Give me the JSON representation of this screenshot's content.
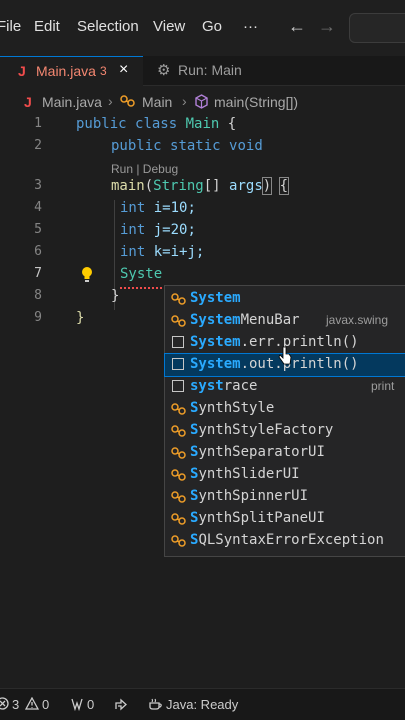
{
  "menubar": {
    "items": [
      "File",
      "Edit",
      "Selection",
      "View",
      "Go",
      "···"
    ],
    "back_icon": "arrow-left-icon",
    "forward_icon": "arrow-right-icon"
  },
  "tabs": [
    {
      "label": "Main.java",
      "icon": "J",
      "problems": "3",
      "close": "×"
    },
    {
      "label": "Run: Main",
      "icon": "run-icon"
    }
  ],
  "breadcrumb": [
    "Main.java",
    "Main",
    "main(String[])"
  ],
  "editor": {
    "line_numbers": [
      "1",
      "2",
      "3",
      "4",
      "5",
      "6",
      "7",
      "8",
      "9"
    ],
    "codelens": "Run | Debug",
    "lines": {
      "l1": {
        "kw1": "public",
        "kw2": "class",
        "cls": "Main",
        "brace": "{"
      },
      "l2": {
        "kw1": "public",
        "kw2": "static",
        "kw3": "void"
      },
      "l3": {
        "fn": "main",
        "open": "(",
        "type": "String",
        "arr": "[] ",
        "param": "args",
        "close": ")",
        "brace": "{"
      },
      "l4": {
        "kw": "int",
        "code": "i=10;"
      },
      "l5": {
        "kw": "int",
        "code": "j=20;"
      },
      "l6": {
        "kw": "int",
        "code": "k=i+j;"
      },
      "l7": {
        "typed": "Syste"
      },
      "l8": {
        "brace": "}"
      },
      "l9": {
        "brace": "}"
      }
    }
  },
  "suggest": {
    "items": [
      {
        "match": "System",
        "rest": "",
        "detail": "",
        "kind": "class-icon"
      },
      {
        "match": "System",
        "rest": "MenuBar",
        "detail": "javax.swing",
        "kind": "class-icon"
      },
      {
        "match": "System",
        "rest": ".err.println()",
        "detail": "",
        "kind": "snippet-icon"
      },
      {
        "match": "System",
        "rest": ".out.println()",
        "detail": "",
        "kind": "snippet-icon"
      },
      {
        "match": "syst",
        "rest": "race",
        "detail": "print",
        "kind": "snippet-icon"
      },
      {
        "match": "S",
        "rest": "ynthStyle",
        "detail": "",
        "kind": "class-icon"
      },
      {
        "match": "S",
        "rest": "ynthStyleFactory",
        "detail": "",
        "kind": "class-icon"
      },
      {
        "match": "S",
        "rest": "ynthSeparatorUI",
        "detail": "",
        "kind": "class-icon"
      },
      {
        "match": "S",
        "rest": "ynthSliderUI",
        "detail": "",
        "kind": "class-icon"
      },
      {
        "match": "S",
        "rest": "ynthSpinnerUI",
        "detail": "",
        "kind": "class-icon"
      },
      {
        "match": "S",
        "rest": "ynthSplitPaneUI",
        "detail": "",
        "kind": "class-icon"
      },
      {
        "match": "S",
        "rest": "QLSyntaxErrorException",
        "detail": "",
        "kind": "class-icon"
      }
    ],
    "selected_index": 3
  },
  "statusbar": {
    "errors": "3",
    "warnings": "0",
    "ports": "0",
    "java_status": "Java: Ready"
  },
  "colors": {
    "keyword": "#569cd6",
    "type": "#4ec9b0",
    "function": "#dcdcaa",
    "variable": "#9cdcfe",
    "match_highlight": "#2aaaff",
    "selection": "#04395e",
    "class_icon": "#ee9d28",
    "error": "#f14c4c"
  }
}
